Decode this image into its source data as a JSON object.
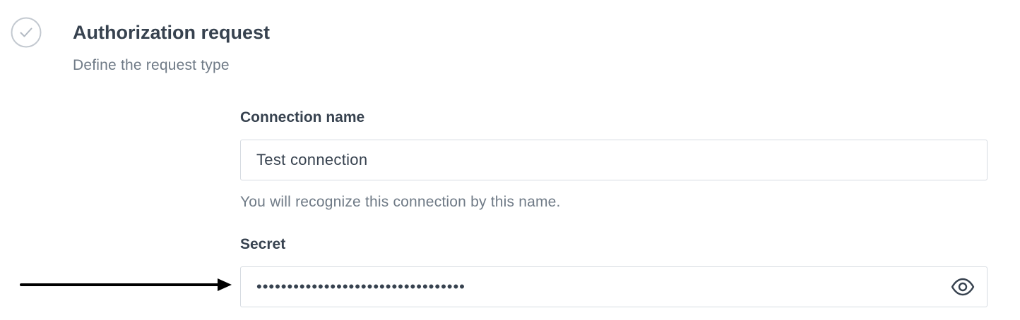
{
  "section": {
    "title": "Authorization request",
    "subtitle": "Define the request type",
    "status_icon": "check-circle-icon"
  },
  "fields": {
    "connection_name": {
      "label": "Connection name",
      "value": "Test connection",
      "helper": "You will recognize this connection by this name."
    },
    "secret": {
      "label": "Secret",
      "value": "••••••••••••••••••••••••••••••••••",
      "toggle_icon": "eye-icon"
    }
  },
  "annotation": {
    "icon": "arrow-right-icon",
    "target": "secret-input"
  },
  "colors": {
    "text_primary": "#37424f",
    "text_secondary": "#6f7a86",
    "border": "#d6dbe1",
    "icon": "#b9c0c8",
    "arrow": "#000000"
  }
}
